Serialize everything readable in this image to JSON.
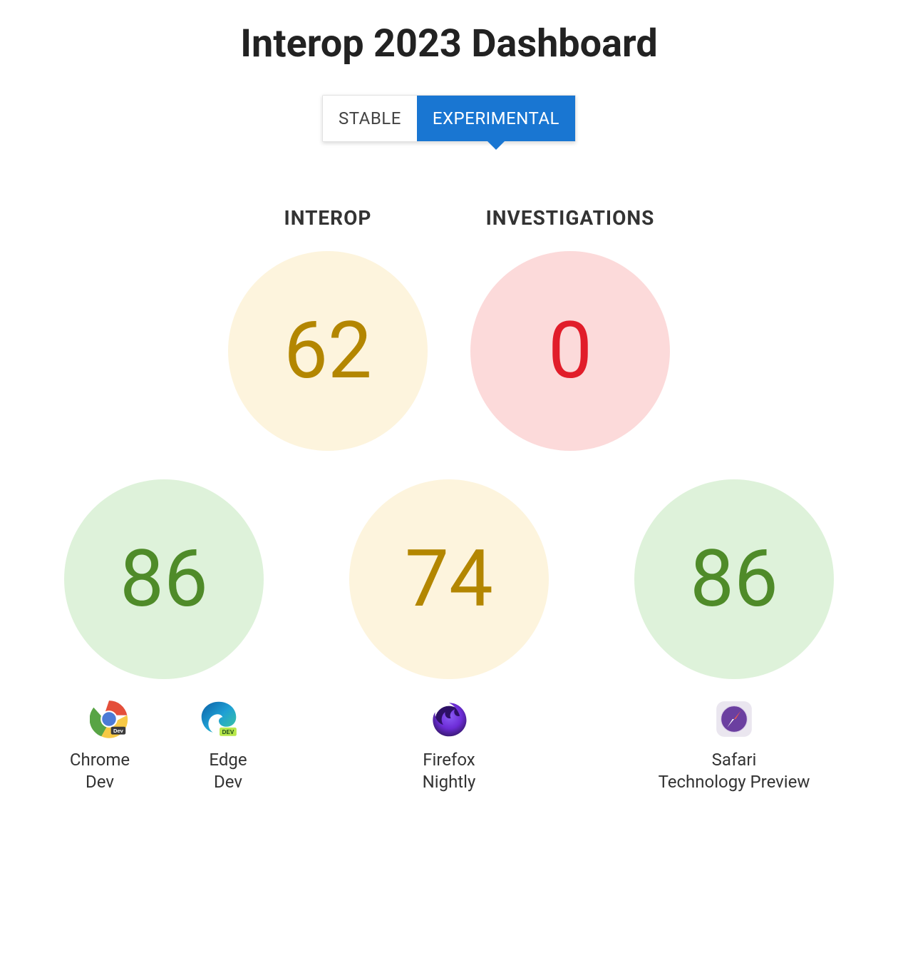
{
  "title": "Interop 2023 Dashboard",
  "tabs": {
    "stable": "STABLE",
    "experimental": "EXPERIMENTAL",
    "active": "experimental"
  },
  "top_scores": {
    "interop": {
      "label": "INTEROP",
      "value": "62"
    },
    "investigations": {
      "label": "INVESTIGATIONS",
      "value": "0"
    }
  },
  "browsers": [
    {
      "score": "86",
      "color": "green",
      "labels": [
        "Chrome\nDev",
        "Edge\nDev"
      ],
      "icons": [
        "chrome-dev-icon",
        "edge-dev-icon"
      ]
    },
    {
      "score": "74",
      "color": "yellow",
      "labels": [
        "Firefox\nNightly"
      ],
      "icons": [
        "firefox-nightly-icon"
      ]
    },
    {
      "score": "86",
      "color": "green",
      "labels": [
        "Safari\nTechnology Preview"
      ],
      "icons": [
        "safari-tp-icon"
      ]
    }
  ]
}
